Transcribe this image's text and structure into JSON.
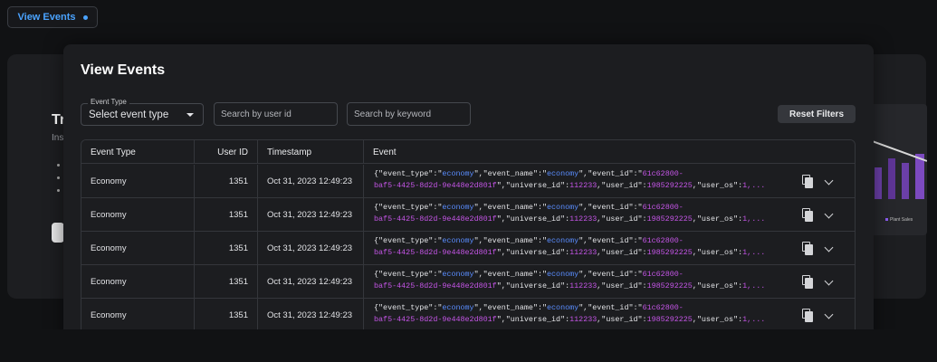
{
  "trigger": {
    "label": "View Events",
    "accent": "#4aa3ff"
  },
  "background": {
    "title": "Tr",
    "subtitle": "Ins",
    "chart_legend": "Plant Sales"
  },
  "modal": {
    "title": "View Events",
    "filters": {
      "event_type_label": "Event Type",
      "event_type_value": "Select event type",
      "user_placeholder": "Search by user id",
      "keyword_placeholder": "Search by keyword",
      "reset_label": "Reset Filters"
    },
    "table": {
      "columns": [
        "Event Type",
        "User ID",
        "Timestamp",
        "Event"
      ],
      "rows": [
        {
          "event_type": "Economy",
          "user_id": "1351",
          "timestamp": "Oct 31, 2023 12:49:23"
        },
        {
          "event_type": "Economy",
          "user_id": "1351",
          "timestamp": "Oct 31, 2023 12:49:23"
        },
        {
          "event_type": "Economy",
          "user_id": "1351",
          "timestamp": "Oct 31, 2023 12:49:23"
        },
        {
          "event_type": "Economy",
          "user_id": "1351",
          "timestamp": "Oct 31, 2023 12:49:23"
        },
        {
          "event_type": "Economy",
          "user_id": "1351",
          "timestamp": "Oct 31, 2023 12:49:23"
        }
      ],
      "event_json": {
        "event_type": "economy",
        "event_name": "economy",
        "event_id_1": "61c62800-",
        "event_id_2": "baf5-4425-8d2d-9e448e2d801f",
        "universe_id": "112233",
        "user_id": "1985292225",
        "user_os": "1,..."
      },
      "row_icons": [
        "copy-icon",
        "chevron-down-icon"
      ]
    }
  }
}
